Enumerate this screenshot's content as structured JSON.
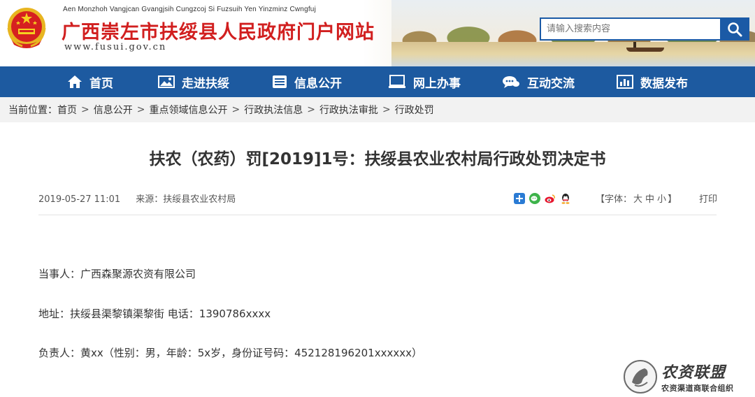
{
  "header": {
    "site_name_en": "Aen Monzhoh Vangjcan Gvangjsih Cungzcoj Si Fuzsuih Yen Yinzminz Cwngfuj",
    "site_name_cn": "广西崇左市扶绥县人民政府门户网站",
    "site_url": "www.fusui.gov.cn",
    "search_placeholder": "请输入搜索内容",
    "emblem_icon": "national-emblem-icon",
    "search_icon": "search-icon"
  },
  "nav": {
    "items": [
      {
        "label": "首页",
        "icon": "home-icon"
      },
      {
        "label": "走进扶绥",
        "icon": "picture-icon"
      },
      {
        "label": "信息公开",
        "icon": "document-icon"
      },
      {
        "label": "网上办事",
        "icon": "laptop-icon"
      },
      {
        "label": "互动交流",
        "icon": "chat-icon"
      },
      {
        "label": "数据发布",
        "icon": "bar-chart-icon"
      }
    ]
  },
  "breadcrumb": {
    "prefix": "当前位置：",
    "items": [
      "首页",
      "信息公开",
      "重点领域信息公开",
      "行政执法信息",
      "行政执法审批",
      "行政处罚"
    ],
    "separator": ">"
  },
  "article": {
    "title": "扶农（农药）罚[2019]1号：扶绥县农业农村局行政处罚决定书",
    "datetime": "2019-05-27 11:01",
    "source": "来源：扶绥县农业农村局",
    "font_label_prefix": "【字体：",
    "font_large": "大",
    "font_medium": "中",
    "font_small": "小",
    "font_label_suffix": "】",
    "print_label": "打印",
    "paragraphs": [
      "当事人：广西森聚源农资有限公司",
      "地址：扶绥县渠黎镇渠黎街  电话：1390786xxxx",
      "负责人：黄xx（性别：男，年龄：5x岁，身份证号码：452128196201xxxxxx）"
    ]
  },
  "share_icons": [
    "share-plus-icon",
    "wechat-icon",
    "weibo-icon",
    "qq-icon"
  ],
  "watermark": {
    "title": "农资联盟",
    "subtitle": "农资渠道商联合组织"
  },
  "colors": {
    "nav_bg": "#1d5aa0",
    "title_red": "#d11f1f",
    "breadcrumb_bg": "#f2f2f2"
  }
}
